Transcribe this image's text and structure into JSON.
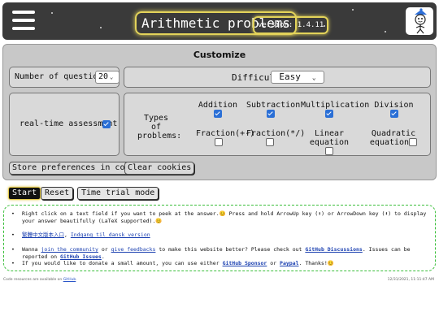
{
  "header": {
    "title": "Arithmetic problems",
    "version": "version: 1.4.11"
  },
  "customize": {
    "title": "Customize",
    "num_questions_label": "Number of questions",
    "num_questions_value": "20",
    "difficulty_label": "Difficulty",
    "difficulty_value": "Easy",
    "realtime_label": "real-time assessment",
    "types_label": "Types of problems:",
    "types": [
      {
        "label": "Addition",
        "checked": true
      },
      {
        "label": "Subtraction",
        "checked": true
      },
      {
        "label": "Multiplication",
        "checked": true
      },
      {
        "label": "Division",
        "checked": true
      },
      {
        "label": "Fraction(+-)",
        "checked": false
      },
      {
        "label": "Fraction(*/)",
        "checked": false
      },
      {
        "label": "Linear equation",
        "checked": false
      },
      {
        "label": "Quadratic equation",
        "checked": false
      }
    ],
    "store_button": "Store preferences in cookies",
    "clear_button": "Clear cookies"
  },
  "actions": {
    "start": "Start",
    "reset": "Reset",
    "time_trial": "Time trial mode"
  },
  "info": {
    "tip": "Right click on a text field if you want to peek at the answer.😊 Press and hold ArrowUp key (⬆) or ArrowDown key (⬇) to display your answer beautifully (LaTeX supported).😊",
    "lang_links": "繁體中文版本入口, Indgang til dansk version",
    "lang_link_zh": "繁體中文版本入口",
    "lang_link_da": "Indgang til dansk version",
    "community_pre": "Wanna",
    "community_link": "join the community",
    "community_mid": "or",
    "feedback_link": "give feedbacks",
    "community_post": "to make this website better? Please check out",
    "discussions_link": "GitHub Discussions",
    "issues_pre": ". Issues can be reported on",
    "issues_link": "GitHub Issues",
    "issues_post": ".",
    "donate_pre": "If you would like to donate a small amount, you can use either",
    "sponsor_link": "GitHub Sponsor",
    "donate_mid": "or",
    "paypal_link": "Paypal",
    "donate_post": ". Thanks!😊"
  },
  "footer": {
    "source_pre": "Code resources are available on",
    "source_link": "GitHub",
    "datetime": "12/31/2021, 11:11:47 AM"
  }
}
